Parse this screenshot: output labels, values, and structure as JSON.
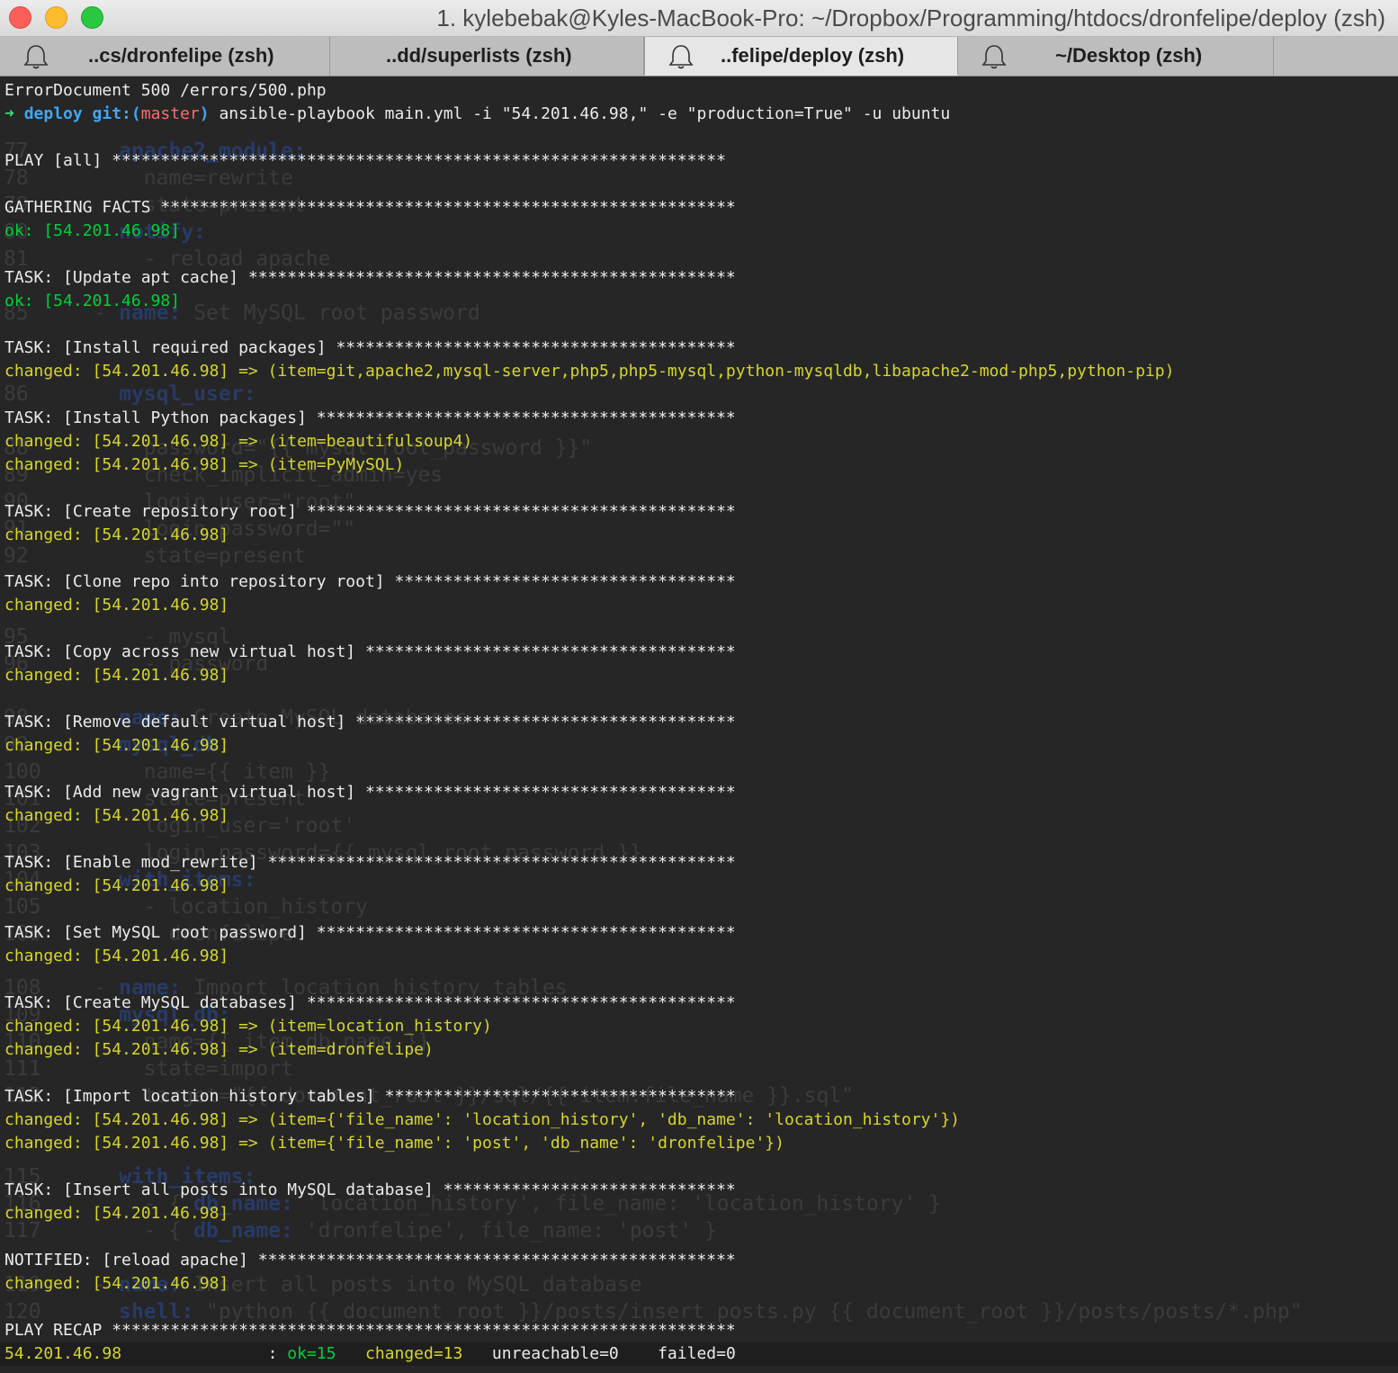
{
  "window": {
    "title": "1. kylebebak@Kyles-MacBook-Pro: ~/Dropbox/Programming/htdocs/dronfelipe/deploy (zsh)"
  },
  "tabs": [
    {
      "label": "..cs/dronfelipe (zsh)",
      "active": false,
      "bell": true
    },
    {
      "label": "..dd/superlists (zsh)",
      "active": false,
      "bell": false
    },
    {
      "label": "..felipe/deploy (zsh)",
      "active": true,
      "bell": true
    },
    {
      "label": "~/Desktop (zsh)",
      "active": false,
      "bell": true
    }
  ],
  "colors": {
    "ok": "#00d13a",
    "changed": "#d6d62c",
    "prompt_dir": "#3ea8f5",
    "branch": "#ff6b6b",
    "background": "#262626"
  },
  "terminal": {
    "lines": [
      {
        "segments": [
          {
            "t": "ErrorDocument 500 /errors/500.php",
            "c": "b"
          }
        ]
      },
      {
        "segments": [
          {
            "t": "➜ ",
            "c": "arrow"
          },
          {
            "t": "deploy ",
            "c": "c"
          },
          {
            "t": "git:(",
            "c": "c"
          },
          {
            "t": "master",
            "c": "r"
          },
          {
            "t": ") ",
            "c": "c"
          },
          {
            "t": "ansible-playbook main.yml -i \"54.201.46.98,\" -e \"production=True\" -u ubuntu",
            "c": "b"
          }
        ]
      },
      {
        "segments": []
      },
      {
        "segments": [
          {
            "t": "PLAY [all] ***************************************************************",
            "c": "b"
          }
        ]
      },
      {
        "segments": []
      },
      {
        "segments": [
          {
            "t": "GATHERING FACTS ***********************************************************",
            "c": "b"
          }
        ]
      },
      {
        "segments": [
          {
            "t": "ok: [54.201.46.98]",
            "c": "g"
          }
        ]
      },
      {
        "segments": []
      },
      {
        "segments": [
          {
            "t": "TASK: [Update apt cache] **************************************************",
            "c": "b"
          }
        ]
      },
      {
        "segments": [
          {
            "t": "ok: [54.201.46.98]",
            "c": "g"
          }
        ]
      },
      {
        "segments": []
      },
      {
        "segments": [
          {
            "t": "TASK: [Install required packages] *****************************************",
            "c": "b"
          }
        ]
      },
      {
        "segments": [
          {
            "t": "changed: [54.201.46.98] => (item=git,apache2,mysql-server,php5,php5-mysql,python-mysqldb,libapache2-mod-php5,python-pip)",
            "c": "y"
          }
        ]
      },
      {
        "segments": []
      },
      {
        "segments": [
          {
            "t": "TASK: [Install Python packages] *******************************************",
            "c": "b"
          }
        ]
      },
      {
        "segments": [
          {
            "t": "changed: [54.201.46.98] => (item=beautifulsoup4)",
            "c": "y"
          }
        ]
      },
      {
        "segments": [
          {
            "t": "changed: [54.201.46.98] => (item=PyMySQL)",
            "c": "y"
          }
        ]
      },
      {
        "segments": []
      },
      {
        "segments": [
          {
            "t": "TASK: [Create repository root] ********************************************",
            "c": "b"
          }
        ]
      },
      {
        "segments": [
          {
            "t": "changed: [54.201.46.98]",
            "c": "y"
          }
        ]
      },
      {
        "segments": []
      },
      {
        "segments": [
          {
            "t": "TASK: [Clone repo into repository root] ***********************************",
            "c": "b"
          }
        ]
      },
      {
        "segments": [
          {
            "t": "changed: [54.201.46.98]",
            "c": "y"
          }
        ]
      },
      {
        "segments": []
      },
      {
        "segments": [
          {
            "t": "TASK: [Copy across new virtual host] **************************************",
            "c": "b"
          }
        ]
      },
      {
        "segments": [
          {
            "t": "changed: [54.201.46.98]",
            "c": "y"
          }
        ]
      },
      {
        "segments": []
      },
      {
        "segments": [
          {
            "t": "TASK: [Remove default virtual host] ***************************************",
            "c": "b"
          }
        ]
      },
      {
        "segments": [
          {
            "t": "changed: [54.201.46.98]",
            "c": "y"
          }
        ]
      },
      {
        "segments": []
      },
      {
        "segments": [
          {
            "t": "TASK: [Add new vagrant virtual host] **************************************",
            "c": "b"
          }
        ]
      },
      {
        "segments": [
          {
            "t": "changed: [54.201.46.98]",
            "c": "y"
          }
        ]
      },
      {
        "segments": []
      },
      {
        "segments": [
          {
            "t": "TASK: [Enable mod_rewrite] ************************************************",
            "c": "b"
          }
        ]
      },
      {
        "segments": [
          {
            "t": "changed: [54.201.46.98]",
            "c": "y"
          }
        ]
      },
      {
        "segments": []
      },
      {
        "segments": [
          {
            "t": "TASK: [Set MySQL root password] *******************************************",
            "c": "b"
          }
        ]
      },
      {
        "segments": [
          {
            "t": "changed: [54.201.46.98]",
            "c": "y"
          }
        ]
      },
      {
        "segments": []
      },
      {
        "segments": [
          {
            "t": "TASK: [Create MySQL databases] ********************************************",
            "c": "b"
          }
        ]
      },
      {
        "segments": [
          {
            "t": "changed: [54.201.46.98] => (item=location_history)",
            "c": "y"
          }
        ]
      },
      {
        "segments": [
          {
            "t": "changed: [54.201.46.98] => (item=dronfelipe)",
            "c": "y"
          }
        ]
      },
      {
        "segments": []
      },
      {
        "segments": [
          {
            "t": "TASK: [Import location history tables] ************************************",
            "c": "b"
          }
        ]
      },
      {
        "segments": [
          {
            "t": "changed: [54.201.46.98] => (item={'file_name': 'location_history', 'db_name': 'location_history'})",
            "c": "y"
          }
        ]
      },
      {
        "segments": [
          {
            "t": "changed: [54.201.46.98] => (item={'file_name': 'post', 'db_name': 'dronfelipe'})",
            "c": "y"
          }
        ]
      },
      {
        "segments": []
      },
      {
        "segments": [
          {
            "t": "TASK: [Insert all posts into MySQL database] ******************************",
            "c": "b"
          }
        ]
      },
      {
        "segments": [
          {
            "t": "changed: [54.201.46.98]",
            "c": "y"
          }
        ]
      },
      {
        "segments": []
      },
      {
        "segments": [
          {
            "t": "NOTIFIED: [reload apache] *************************************************",
            "c": "b"
          }
        ]
      },
      {
        "segments": [
          {
            "t": "changed: [54.201.46.98]",
            "c": "y"
          }
        ]
      },
      {
        "segments": []
      },
      {
        "segments": [
          {
            "t": "PLAY RECAP ****************************************************************",
            "c": "b"
          }
        ]
      },
      {
        "recap": true,
        "segments": [
          {
            "t": "54.201.46.98",
            "c": "y"
          },
          {
            "t": "               : ",
            "c": "b"
          },
          {
            "t": "ok=15",
            "c": "g"
          },
          {
            "t": "   ",
            "c": "b"
          },
          {
            "t": "changed=13",
            "c": "y"
          },
          {
            "t": "   unreachable=0    failed=0",
            "c": "b"
          }
        ]
      }
    ]
  },
  "background_editor": {
    "lines": [
      {
        "n": "77",
        "pre": "      ",
        "kw": "apache2_module:",
        "text": ""
      },
      {
        "n": "78",
        "pre": "        ",
        "kw": "",
        "text": "name=rewrite"
      },
      {
        "n": "79",
        "pre": "        ",
        "kw": "",
        "text": "state=present"
      },
      {
        "n": "80",
        "pre": "      ",
        "kw": "notify:",
        "text": ""
      },
      {
        "n": "81",
        "pre": "        ",
        "kw": "",
        "text": "- reload apache"
      },
      {
        "n": "85",
        "pre": "    - ",
        "kw": "name:",
        "text": " Set MySQL root password"
      },
      {
        "n": "86",
        "pre": "      ",
        "kw": "mysql_user:",
        "text": ""
      },
      {
        "n": "88",
        "pre": "        ",
        "kw": "",
        "text": "password=\"{{ mysql_root_password }}\""
      },
      {
        "n": "89",
        "pre": "        ",
        "kw": "",
        "text": "check_implicit_admin=yes"
      },
      {
        "n": "90",
        "pre": "        ",
        "kw": "",
        "text": "login_user=\"root\""
      },
      {
        "n": "91",
        "pre": "        ",
        "kw": "",
        "text": "login_password=\"\""
      },
      {
        "n": "92",
        "pre": "        ",
        "kw": "",
        "text": "state=present"
      },
      {
        "n": "95",
        "pre": "        ",
        "kw": "",
        "text": "- mysql"
      },
      {
        "n": "96",
        "pre": "        ",
        "kw": "",
        "text": "- password"
      },
      {
        "n": "98",
        "pre": "    - ",
        "kw": "name:",
        "text": " Create MySQL databases"
      },
      {
        "n": "99",
        "pre": "      ",
        "kw": "mysql_db:",
        "text": ""
      },
      {
        "n": "100",
        "pre": "        ",
        "kw": "",
        "text": "name={{ item }}"
      },
      {
        "n": "101",
        "pre": "        ",
        "kw": "",
        "text": "state=present"
      },
      {
        "n": "102",
        "pre": "        ",
        "kw": "",
        "text": "login_user='root'"
      },
      {
        "n": "103",
        "pre": "        ",
        "kw": "",
        "text": "login_password={{ mysql_root_password }}"
      },
      {
        "n": "104",
        "pre": "      ",
        "kw": "with_items:",
        "text": ""
      },
      {
        "n": "105",
        "pre": "        ",
        "kw": "",
        "text": "- location_history"
      },
      {
        "n": "106",
        "pre": "        ",
        "kw": "",
        "text": "- dronfelipe"
      },
      {
        "n": "108",
        "pre": "    - ",
        "kw": "name:",
        "text": " Import location history tables"
      },
      {
        "n": "109",
        "pre": "      ",
        "kw": "mysql_db:",
        "text": ""
      },
      {
        "n": "110",
        "pre": "        ",
        "kw": "",
        "text": "name={{ item.db_name }}"
      },
      {
        "n": "111",
        "pre": "        ",
        "kw": "",
        "text": "state=import"
      },
      {
        "n": "112",
        "pre": "        ",
        "kw": "",
        "text": "target=\"{{ document_root }}/sql/{{ item.file_name }}.sql\""
      },
      {
        "n": "115",
        "pre": "      ",
        "kw": "with_items:",
        "text": ""
      },
      {
        "n": "116",
        "pre": "        - { ",
        "kw": "db_name:",
        "text": " 'location_history', file_name: 'location_history' }"
      },
      {
        "n": "117",
        "pre": "        - { ",
        "kw": "db_name:",
        "text": " 'dronfelipe', file_name: 'post' }"
      },
      {
        "n": "119",
        "pre": "    - ",
        "kw": "name:",
        "text": " Insert all posts into MySQL database"
      },
      {
        "n": "120",
        "pre": "      ",
        "kw": "shell:",
        "text": " \"python {{ document_root }}/posts/insert_posts.py {{ document_root }}/posts/posts/*.php\""
      }
    ]
  }
}
